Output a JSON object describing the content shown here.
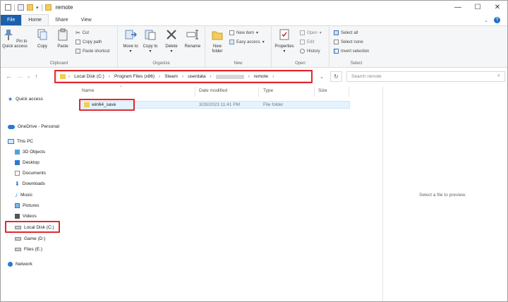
{
  "window": {
    "title": "remote"
  },
  "controls": {
    "minimize": "—",
    "maximize": "☐",
    "close": "✕"
  },
  "tabs": [
    "File",
    "Home",
    "Share",
    "View"
  ],
  "ribbon": {
    "clipboard": {
      "label": "Clipboard",
      "pin": "Pin to Quick access",
      "copy": "Copy",
      "paste": "Paste",
      "cut": "Cut",
      "copy_path": "Copy path",
      "paste_shortcut": "Paste shortcut"
    },
    "organize": {
      "label": "Organize",
      "move_to": "Move to",
      "copy_to": "Copy to",
      "delete": "Delete",
      "rename": "Rename"
    },
    "new": {
      "label": "New",
      "new_folder": "New folder",
      "new_item": "New item",
      "easy_access": "Easy access"
    },
    "open": {
      "label": "Open",
      "properties": "Properties",
      "open": "Open",
      "edit": "Edit",
      "history": "History"
    },
    "select": {
      "label": "Select",
      "select_all": "Select all",
      "select_none": "Select none",
      "invert": "Invert selection"
    }
  },
  "address": {
    "crumbs": [
      "Local Disk (C:)",
      "Program Files (x86)",
      "Steam",
      "userdata",
      "",
      "remote"
    ],
    "search_placeholder": "Search remote"
  },
  "nav": {
    "quick_access": "Quick access",
    "onedrive": "OneDrive - Personal",
    "this_pc": "This PC",
    "items": [
      "3D Objects",
      "Desktop",
      "Documents",
      "Downloads",
      "Music",
      "Pictures",
      "Videos",
      "Local Disk (C:)",
      "Game (D:)",
      "Files (E:)"
    ],
    "network": "Network"
  },
  "columns": {
    "name": "Name",
    "date": "Date modified",
    "type": "Type",
    "size": "Size"
  },
  "files": [
    {
      "name": "win64_save",
      "date": "3/28/2023 11:41 PM",
      "type": "File folder",
      "size": ""
    }
  ],
  "preview": {
    "text": "Select a file to preview."
  }
}
